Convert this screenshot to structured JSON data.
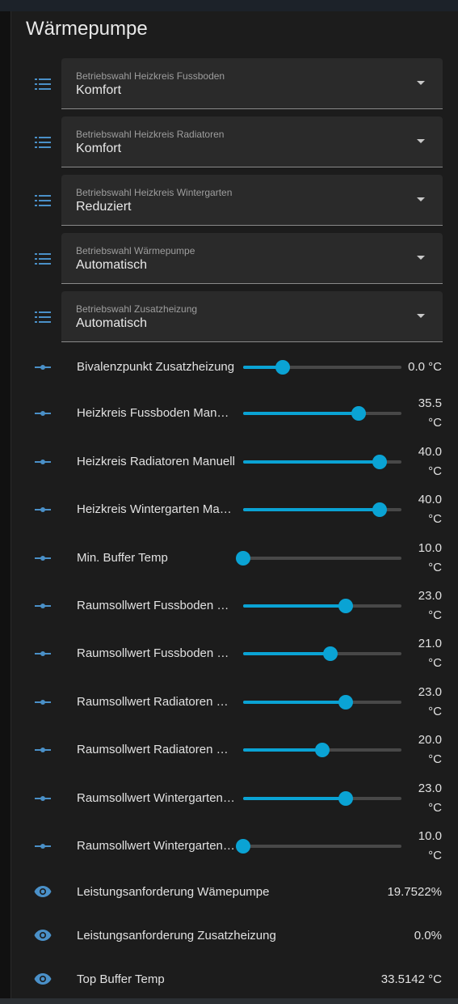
{
  "card": {
    "title": "Wärmepumpe"
  },
  "colors": {
    "accent": "#0aa3d4",
    "icon": "#4a90c8",
    "background": "#1c1c1c"
  },
  "selects": [
    {
      "icon": "list-icon",
      "label": "Betriebswahl Heizkreis Fussboden",
      "value": "Komfort"
    },
    {
      "icon": "list-icon",
      "label": "Betriebswahl Heizkreis Radiatoren",
      "value": "Komfort"
    },
    {
      "icon": "list-icon",
      "label": "Betriebswahl Heizkreis Wintergarten",
      "value": "Reduziert"
    },
    {
      "icon": "list-icon",
      "label": "Betriebswahl Wärmepumpe",
      "value": "Automatisch"
    },
    {
      "icon": "list-icon",
      "label": "Betriebswahl Zusatzheizung",
      "value": "Automatisch"
    }
  ],
  "sliders": [
    {
      "icon": "slider-icon",
      "name": "Bivalenzpunkt Zusatzheizung",
      "value_text": "0.0 °C",
      "unit": "",
      "level": 0.25
    },
    {
      "icon": "slider-icon",
      "name": "Heizkreis Fussboden Manuell",
      "value_text": "35.5",
      "unit": "°C",
      "level": 0.73
    },
    {
      "icon": "slider-icon",
      "name": "Heizkreis Radiatoren Manuell",
      "value_text": "40.0",
      "unit": "°C",
      "level": 0.86
    },
    {
      "icon": "slider-icon",
      "name": "Heizkreis Wintergarten Manuell",
      "value_text": "40.0",
      "unit": "°C",
      "level": 0.86
    },
    {
      "icon": "slider-icon",
      "name": "Min. Buffer Temp",
      "value_text": "10.0",
      "unit": "°C",
      "level": 0.0
    },
    {
      "icon": "slider-icon",
      "name": "Raumsollwert Fussboden Komfort",
      "value_text": "23.0",
      "unit": "°C",
      "level": 0.65
    },
    {
      "icon": "slider-icon",
      "name": "Raumsollwert Fussboden Reduziert",
      "value_text": "21.0",
      "unit": "°C",
      "level": 0.55
    },
    {
      "icon": "slider-icon",
      "name": "Raumsollwert Radiatoren Komfort",
      "value_text": "23.0",
      "unit": "°C",
      "level": 0.65
    },
    {
      "icon": "slider-icon",
      "name": "Raumsollwert Radiatoren Reduziert",
      "value_text": "20.0",
      "unit": "°C",
      "level": 0.5
    },
    {
      "icon": "slider-icon",
      "name": "Raumsollwert Wintergarten Komfort",
      "value_text": "23.0",
      "unit": "°C",
      "level": 0.65
    },
    {
      "icon": "slider-icon",
      "name": "Raumsollwert Wintergarten Reduziert",
      "value_text": "10.0",
      "unit": "°C",
      "level": 0.0
    }
  ],
  "sensors": [
    {
      "icon": "eye-icon",
      "name": "Leistungsanforderung Wämepumpe",
      "value": "19.7522%"
    },
    {
      "icon": "eye-icon",
      "name": "Leistungsanforderung Zusatzheizung",
      "value": "0.0%"
    },
    {
      "icon": "eye-icon",
      "name": "Top Buffer Temp",
      "value": "33.5142 °C"
    }
  ]
}
